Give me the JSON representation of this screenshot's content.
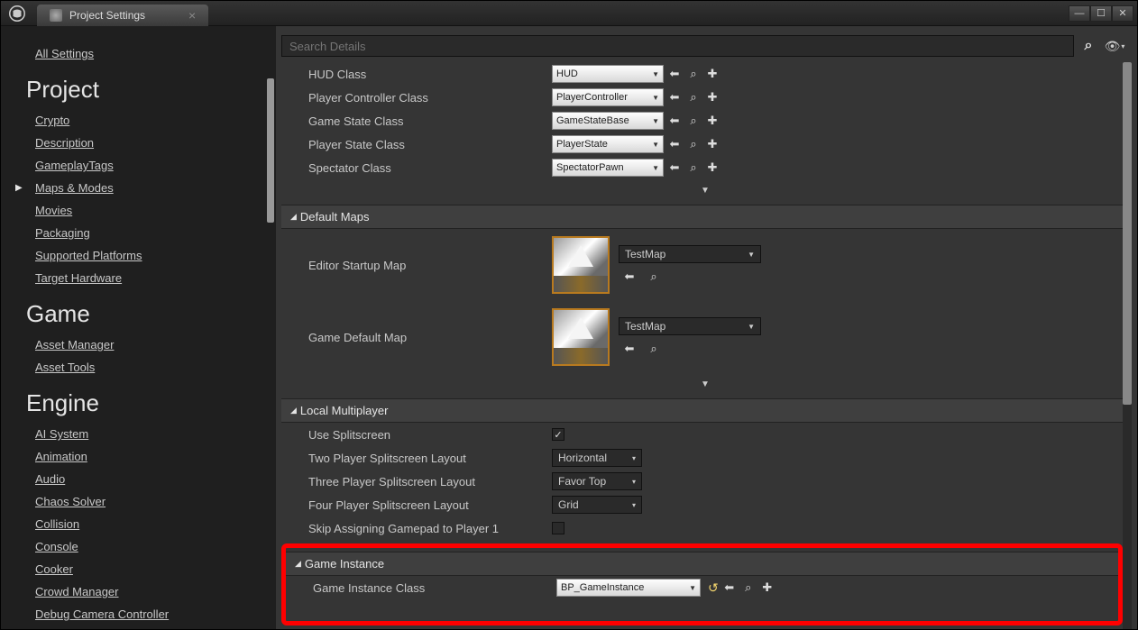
{
  "tab": {
    "title": "Project Settings"
  },
  "sidebar": {
    "all": "All Settings",
    "sections": [
      {
        "title": "Project",
        "items": [
          "Crypto",
          "Description",
          "GameplayTags",
          "Maps & Modes",
          "Movies",
          "Packaging",
          "Supported Platforms",
          "Target Hardware"
        ],
        "selectedIndex": 3
      },
      {
        "title": "Game",
        "items": [
          "Asset Manager",
          "Asset Tools"
        ]
      },
      {
        "title": "Engine",
        "items": [
          "AI System",
          "Animation",
          "Audio",
          "Chaos Solver",
          "Collision",
          "Console",
          "Cooker",
          "Crowd Manager",
          "Debug Camera Controller"
        ]
      }
    ]
  },
  "search": {
    "placeholder": "Search Details"
  },
  "classes": [
    {
      "label": "HUD Class",
      "value": "HUD"
    },
    {
      "label": "Player Controller Class",
      "value": "PlayerController"
    },
    {
      "label": "Game State Class",
      "value": "GameStateBase"
    },
    {
      "label": "Player State Class",
      "value": "PlayerState"
    },
    {
      "label": "Spectator Class",
      "value": "SpectatorPawn"
    }
  ],
  "sections": {
    "defaultMaps": "Default Maps",
    "localMultiplayer": "Local Multiplayer",
    "gameInstance": "Game Instance"
  },
  "maps": {
    "editorStartup": {
      "label": "Editor Startup Map",
      "value": "TestMap"
    },
    "gameDefault": {
      "label": "Game Default Map",
      "value": "TestMap"
    }
  },
  "multiplayer": {
    "useSplitscreen": {
      "label": "Use Splitscreen",
      "checked": true
    },
    "twoPlayer": {
      "label": "Two Player Splitscreen Layout",
      "value": "Horizontal"
    },
    "threePlayer": {
      "label": "Three Player Splitscreen Layout",
      "value": "Favor Top"
    },
    "fourPlayer": {
      "label": "Four Player Splitscreen Layout",
      "value": "Grid"
    },
    "skipGamepad": {
      "label": "Skip Assigning Gamepad to Player 1",
      "checked": false
    }
  },
  "gameInstance": {
    "label": "Game Instance Class",
    "value": "BP_GameInstance"
  }
}
